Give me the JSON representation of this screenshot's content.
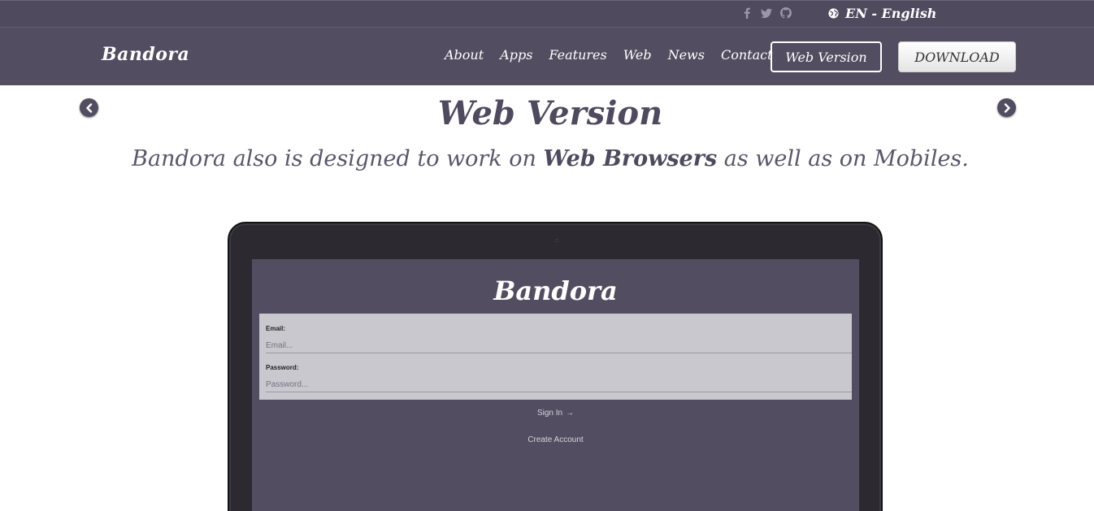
{
  "topbar": {
    "social": [
      "facebook-icon",
      "twitter-icon",
      "github-icon"
    ],
    "language_label": "EN - English"
  },
  "navbar": {
    "brand": "Bandora",
    "links": [
      "About",
      "Apps",
      "Features",
      "Web",
      "News",
      "Contact"
    ],
    "web_version_button": "Web Version",
    "download_button": "DOWNLOAD"
  },
  "hero": {
    "title": "Web Version",
    "subtitle_before": "Bandora also is designed to work on ",
    "subtitle_bold": "Web Browsers",
    "subtitle_after": " as well as on Mobiles."
  },
  "laptop_screen": {
    "brand": "Bandora",
    "email_label": "Email:",
    "email_placeholder": "Email...",
    "password_label": "Password:",
    "password_placeholder": "Password...",
    "sign_in": "Sign In",
    "create_account": "Create Account"
  },
  "colors": {
    "header_bg": "#524d60",
    "topbar_bg": "#4f4a5e",
    "accent_text": "#4f4a5e"
  }
}
